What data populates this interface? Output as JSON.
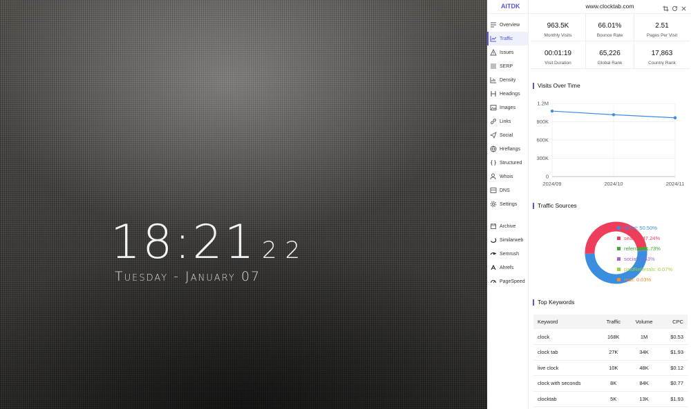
{
  "clock": {
    "hours_minutes": "18:21",
    "seconds": "22",
    "date": "Tuesday - January 07"
  },
  "panel": {
    "brand": "AITDK",
    "domain": "www.clocktab.com",
    "nav": [
      {
        "label": "Overview",
        "icon": "overview-icon"
      },
      {
        "label": "Traffic",
        "icon": "chart-icon",
        "active": true
      },
      {
        "label": "Issues",
        "icon": "warning-icon"
      },
      {
        "label": "SERP",
        "icon": "list-icon"
      },
      {
        "label": "Density",
        "icon": "density-icon"
      },
      {
        "label": "Headings",
        "icon": "heading-icon"
      },
      {
        "label": "Images",
        "icon": "image-icon"
      },
      {
        "label": "Links",
        "icon": "link-icon"
      },
      {
        "label": "Social",
        "icon": "social-icon"
      },
      {
        "label": "Hreflangs",
        "icon": "globe-icon"
      },
      {
        "label": "Structured",
        "icon": "braces-icon"
      },
      {
        "label": "Whois",
        "icon": "person-icon"
      },
      {
        "label": "DNS",
        "icon": "dns-icon"
      },
      {
        "label": "Settings",
        "icon": "gear-icon"
      }
    ],
    "external": [
      {
        "label": "Archive",
        "icon": "archive-icon"
      },
      {
        "label": "Similarweb",
        "icon": "similarweb-icon"
      },
      {
        "label": "Semrush",
        "icon": "semrush-icon"
      },
      {
        "label": "Ahrefs",
        "icon": "ahrefs-icon"
      },
      {
        "label": "PageSpeed",
        "icon": "pagespeed-icon"
      }
    ],
    "stats": [
      {
        "value": "963.5K",
        "label": "Monthly Visits"
      },
      {
        "value": "66.01%",
        "label": "Bounce Rate"
      },
      {
        "value": "2.51",
        "label": "Pages Per Visit"
      },
      {
        "value": "00:01:19",
        "label": "Visit Duration"
      },
      {
        "value": "65,226",
        "label": "Global Rank"
      },
      {
        "value": "17,863",
        "label": "Country Rank"
      }
    ],
    "visits_title": "Visits Over Time",
    "sources_title": "Traffic Sources",
    "keywords_title": "Top Keywords",
    "sources": [
      {
        "label": "direct: 50.50%",
        "value": 50.5,
        "color": "#3b8de0"
      },
      {
        "label": "search: 47.24%",
        "value": 47.24,
        "color": "#ef3e5b"
      },
      {
        "label": "referrals: 1.73%",
        "value": 1.73,
        "color": "#3aaa35"
      },
      {
        "label": "social: 0.43%",
        "value": 0.43,
        "color": "#a25fd6"
      },
      {
        "label": "paidReferrals: 0.07%",
        "value": 0.07,
        "color": "#9bd13b"
      },
      {
        "label": "mail: 0.03%",
        "value": 0.03,
        "color": "#f28a2e"
      }
    ],
    "keywords": {
      "headers": [
        "Keyword",
        "Traffic",
        "Volume",
        "CPC"
      ],
      "rows": [
        [
          "clock",
          "168K",
          "1M",
          "$0.53"
        ],
        [
          "clock tab",
          "27K",
          "34K",
          "$1.93"
        ],
        [
          "live clock",
          "10K",
          "48K",
          "$0.12"
        ],
        [
          "clock with seconds",
          "8K",
          "84K",
          "$0.77"
        ],
        [
          "clocktab",
          "5K",
          "13K",
          "$1.93"
        ]
      ]
    }
  },
  "chart_data": {
    "type": "line",
    "title": "Visits Over Time",
    "x": [
      "2024/09",
      "2024/10",
      "2024/11"
    ],
    "y_ticks": [
      "0",
      "300K",
      "600K",
      "900K",
      "1.2M"
    ],
    "ylim": [
      0,
      1200000
    ],
    "series": [
      {
        "values": [
          1075000,
          1015000,
          965000
        ],
        "color": "#3b8de0"
      }
    ],
    "grid": true
  }
}
